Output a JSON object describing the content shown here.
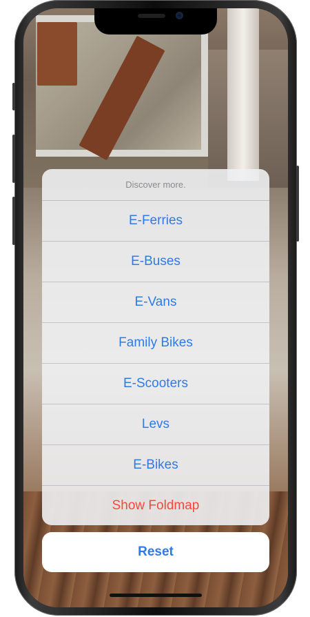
{
  "action_sheet": {
    "title": "Discover more.",
    "items": [
      {
        "label": "E-Ferries"
      },
      {
        "label": "E-Buses"
      },
      {
        "label": "E-Vans"
      },
      {
        "label": "Family Bikes"
      },
      {
        "label": "E-Scooters"
      },
      {
        "label": "Levs"
      },
      {
        "label": "E-Bikes"
      }
    ],
    "destructive_label": "Show Foldmap",
    "cancel_label": "Reset"
  },
  "colors": {
    "accent": "#2f7ae5",
    "destructive": "#f2483e",
    "sheet_title": "#8a8a8e"
  }
}
